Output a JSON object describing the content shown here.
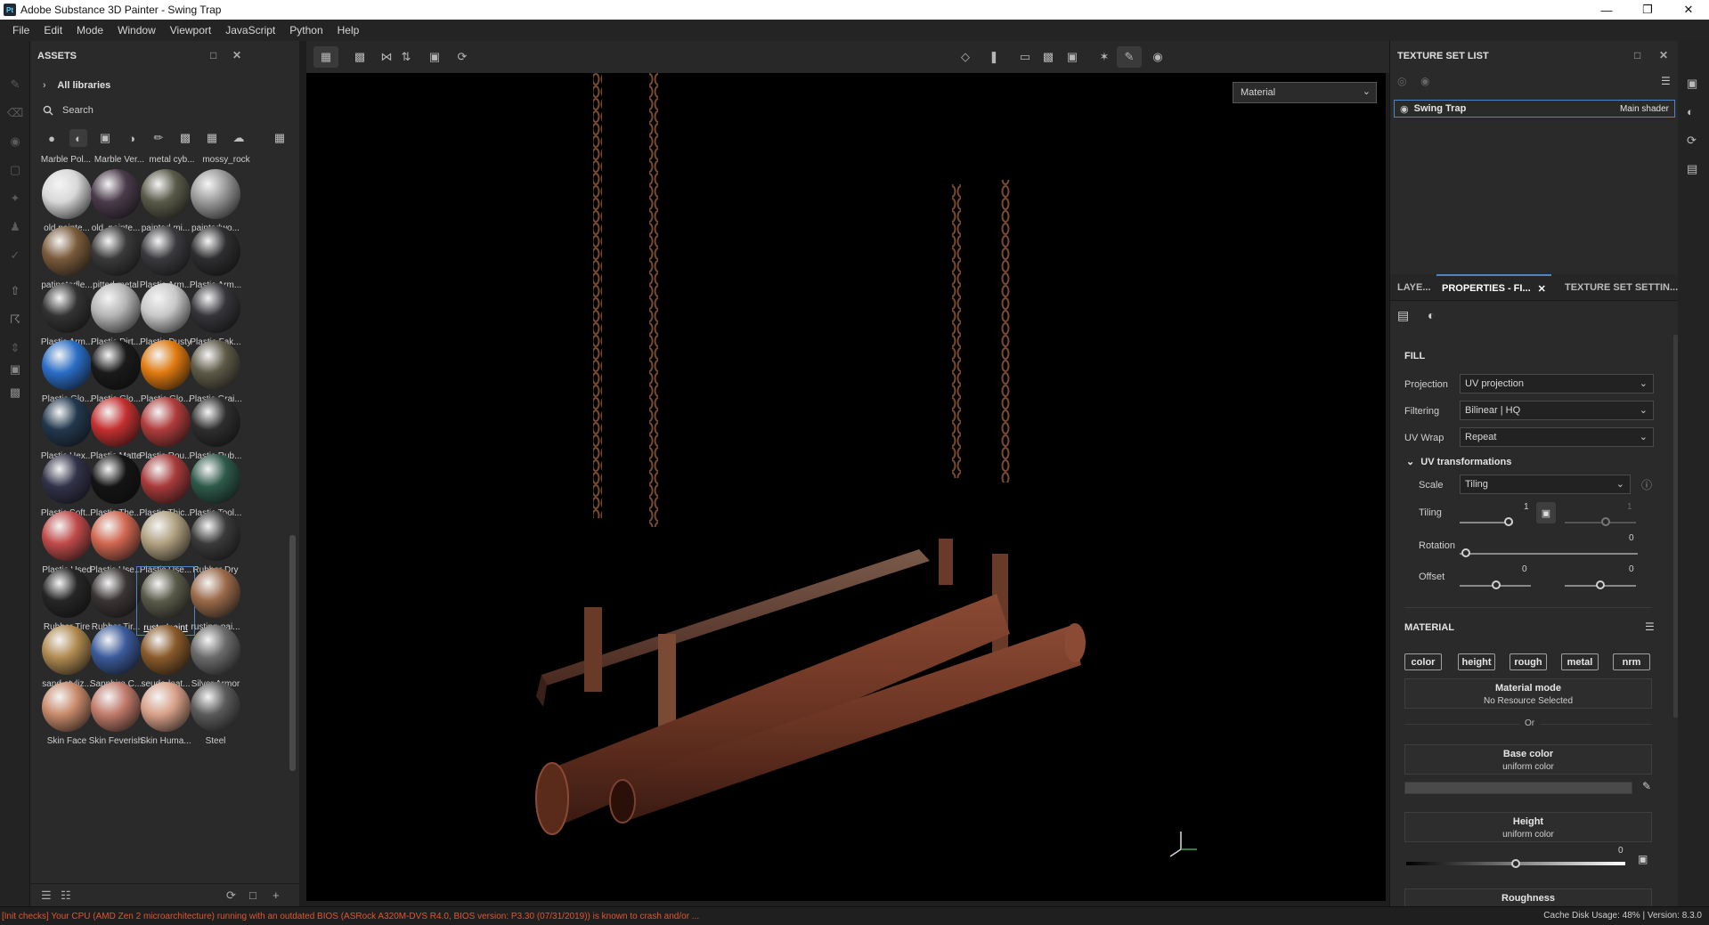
{
  "window": {
    "title": "Adobe Substance 3D Painter - Swing Trap",
    "app_icon": "Pt",
    "controls": [
      "minimize-icon",
      "maximize-icon",
      "close-icon"
    ]
  },
  "menu": [
    "File",
    "Edit",
    "Mode",
    "Window",
    "Viewport",
    "JavaScript",
    "Python",
    "Help"
  ],
  "assets": {
    "title": "ASSETS",
    "all_libraries": "All libraries",
    "search_placeholder": "Search",
    "top_row": [
      "Marble Pol...",
      "Marble Ver...",
      "metal cyb...",
      "mossy_rock"
    ],
    "materials": [
      {
        "label": "old painte...",
        "color": "#d8d8d8"
      },
      {
        "label": "old_painte...",
        "color": "#4a3a4a"
      },
      {
        "label": "painted mi...",
        "color": "#5a5a4a"
      },
      {
        "label": "paintedwo...",
        "color": "#9a9a9a"
      },
      {
        "label": "patinatedle...",
        "color": "#7a5a3a"
      },
      {
        "label": "pitted metal",
        "color": "#3a3a3a"
      },
      {
        "label": "Plastic Arm...",
        "color": "#3a3a3e"
      },
      {
        "label": "Plastic Arm...",
        "color": "#2e2e30"
      },
      {
        "label": "Plastic Arm...",
        "color": "#333333"
      },
      {
        "label": "Plastic Dirt...",
        "color": "#b5b5b5"
      },
      {
        "label": "Plastic Dusty",
        "color": "#c8c8c8"
      },
      {
        "label": "Plastic Fak...",
        "color": "#35353a"
      },
      {
        "label": "Plastic Glo...",
        "color": "#2a6ec6"
      },
      {
        "label": "Plastic Glo...",
        "color": "#1a1a1a"
      },
      {
        "label": "Plastic Glo...",
        "color": "#e07a10"
      },
      {
        "label": "Plastic Grai...",
        "color": "#5e5a48"
      },
      {
        "label": "Plastic Hex...",
        "color": "#22384e"
      },
      {
        "label": "Plastic Matte",
        "color": "#c43030"
      },
      {
        "label": "Plastic Rou...",
        "color": "#b03c3c"
      },
      {
        "label": "Plastic Rub...",
        "color": "#2e2e2e"
      },
      {
        "label": "Plastic Soft...",
        "color": "#32324a"
      },
      {
        "label": "Plastic The...",
        "color": "#141414"
      },
      {
        "label": "Plastic Thic...",
        "color": "#a83a3a"
      },
      {
        "label": "Plastic Tool...",
        "color": "#2e5a4a"
      },
      {
        "label": "Plastic Used",
        "color": "#c04a4a"
      },
      {
        "label": "Plastic Use...",
        "color": "#d06650"
      },
      {
        "label": "Plastic Use...",
        "color": "#b0a080"
      },
      {
        "label": "Rubber Dry",
        "color": "#3a3a3a"
      },
      {
        "label": "Rubber Tire",
        "color": "#262626"
      },
      {
        "label": "Rubber Tir...",
        "color": "#3a3434"
      },
      {
        "label": "rustedpaint",
        "color": "#5a5a4a",
        "selected": true
      },
      {
        "label": "rusting-pai...",
        "color": "#9a6a4a"
      },
      {
        "label": "sand-styliz...",
        "color": "#b08a50"
      },
      {
        "label": "Sapphire C...",
        "color": "#3a5a9a"
      },
      {
        "label": "seude-leat...",
        "color": "#8a5a2a"
      },
      {
        "label": "Silver Armor",
        "color": "#6a6a6a"
      },
      {
        "label": "Skin Face",
        "color": "#c88a6a"
      },
      {
        "label": "Skin Feverish",
        "color": "#c07a6a"
      },
      {
        "label": "Skin Huma...",
        "color": "#d8a088"
      },
      {
        "label": "Steel",
        "color": "#5a5a5a"
      }
    ]
  },
  "viewport": {
    "display_mode": "Material"
  },
  "texture_set_list": {
    "title": "TEXTURE SET LIST",
    "item_name": "Swing Trap",
    "item_shader": "Main shader"
  },
  "properties": {
    "tabs": [
      "LAYE...",
      "PROPERTIES - FI...",
      "TEXTURE SET SETTIN..."
    ],
    "fill_heading": "FILL",
    "projection_label": "Projection",
    "projection_value": "UV projection",
    "filtering_label": "Filtering",
    "filtering_value": "Bilinear | HQ",
    "uvwrap_label": "UV Wrap",
    "uvwrap_value": "Repeat",
    "uv_transform_heading": "UV transformations",
    "scale_label": "Scale",
    "scale_value": "Tiling",
    "tiling_label": "Tiling",
    "tiling_value": "1",
    "tiling_value_locked": "1",
    "rotation_label": "Rotation",
    "rotation_value": "0",
    "offset_label": "Offset",
    "offset_u": "0",
    "offset_v": "0",
    "material_heading": "MATERIAL",
    "channels": [
      "color",
      "height",
      "rough",
      "metal",
      "nrm"
    ],
    "material_mode_title": "Material mode",
    "material_mode_sub": "No Resource Selected",
    "or_text": "Or",
    "base_color_title": "Base color",
    "base_color_sub": "uniform color",
    "height_title": "Height",
    "height_sub": "uniform color",
    "height_value": "0",
    "roughness_title": "Roughness"
  },
  "status": {
    "message": "[Init checks] Your CPU (AMD Zen 2 microarchitecture) running with an outdated BIOS (ASRock A320M-DVS R4.0, BIOS version: P3.30 (07/31/2019)) is known to crash and/or ...",
    "cache": "Cache Disk Usage:   48% | Version: 8.3.0"
  },
  "colors": {
    "accent": "#4c86c6",
    "status_warning": "#e0562f",
    "panel_bg": "#2a2a2a"
  }
}
